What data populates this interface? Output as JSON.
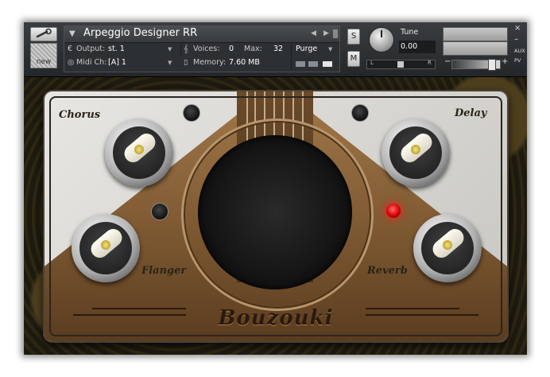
{
  "header": {
    "instrument_name": "Arpeggio Designer RR",
    "output_label": "Output:",
    "output_value": "st. 1",
    "voices_label": "Voices:",
    "voices_value": "0",
    "max_label": "Max:",
    "max_value": "32",
    "purge_label": "Purge",
    "midi_label": "Midi Ch:",
    "midi_value": "[A]  1",
    "memory_label": "Memory:",
    "memory_value": "7.60 MB",
    "new_label": "new",
    "solo_label": "S",
    "mute_label": "M",
    "tune_label": "Tune",
    "tune_value": "0.00",
    "pan_left": "L",
    "pan_right": "R",
    "vol_minus": "−",
    "vol_plus": "+",
    "aux_label": "AUX",
    "pv_label": "PV",
    "close_label": "×",
    "min_label": "–"
  },
  "panel": {
    "chorus_label": "Chorus",
    "delay_label": "Delay",
    "flanger_label": "Flanger",
    "reverb_label": "Reverb",
    "brand": "Bouzouki"
  },
  "colors": {
    "led_active": "#d40000",
    "wood": "#7a5630",
    "plate": "#d9d8d3"
  },
  "icons": {
    "tool": "wrench-icon",
    "output": "output-icon",
    "midi": "midi-icon",
    "voices": "voices-icon",
    "memory": "memory-icon"
  }
}
